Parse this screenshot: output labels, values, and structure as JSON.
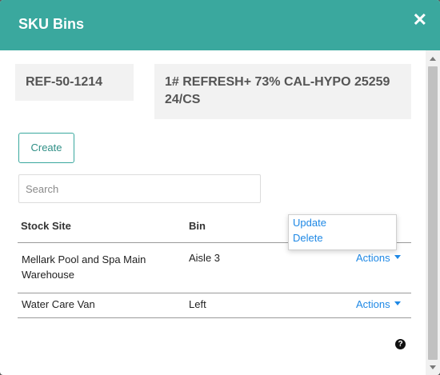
{
  "modal": {
    "title": "SKU Bins",
    "close_glyph": "✕"
  },
  "sku": {
    "ref": "REF-50-1214",
    "description": "1# REFRESH+ 73% CAL-HYPO 25259 24/CS"
  },
  "create_label": "Create",
  "search": {
    "placeholder": "Search",
    "value": ""
  },
  "table": {
    "headers": [
      "Stock Site",
      "Bin"
    ],
    "rows": [
      {
        "stock_site": "Mellark Pool and Spa Main Warehouse",
        "bin": "Aisle 3",
        "actions": "Actions"
      },
      {
        "stock_site": "Water Care Van",
        "bin": "Left",
        "actions": "Actions"
      }
    ]
  },
  "dropdown": {
    "items": [
      "Update",
      "Delete"
    ]
  },
  "help_glyph": "?",
  "colors": {
    "header_bg": "#3aa89e",
    "link": "#1e88e5"
  },
  "icons": [
    "close-icon",
    "caret-down-icon",
    "help-icon"
  ]
}
